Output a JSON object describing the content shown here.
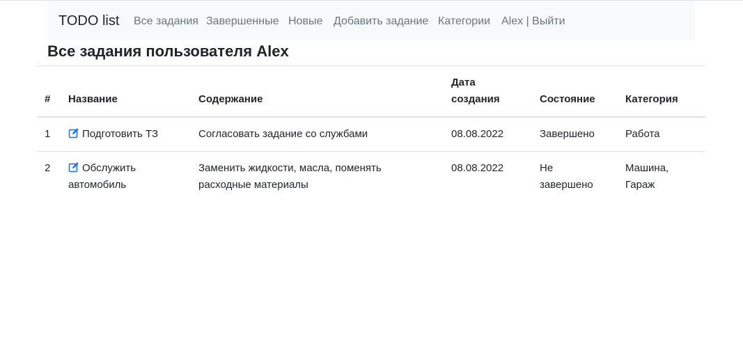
{
  "navbar": {
    "brand": "TODO list",
    "links": [
      "Все задания",
      "Завершенные",
      "Новые",
      "Добавить задание",
      "Категории",
      "Alex | Выйти"
    ]
  },
  "page": {
    "title": "Все задания пользователя Alex"
  },
  "table": {
    "headers": {
      "num": "#",
      "name": "Название",
      "content": "Содержание",
      "date_line1": "Дата",
      "date_line2": "создания",
      "state": "Состояние",
      "category": "Категория"
    },
    "rows": [
      {
        "num": "1",
        "name_line1": "Подготовить ТЗ",
        "content_line1": "Согласовать задание со службами",
        "date": "08.08.2022",
        "state_line1": "Завершено",
        "category_line1": "Работа"
      },
      {
        "num": "2",
        "name_line1": "Обслужить",
        "name_line2": "автомобиль",
        "content_line1": "Заменить жидкости, масла, поменять",
        "content_line2": "расходные материалы",
        "date": "08.08.2022",
        "state_line1": "Не",
        "state_line2": "завершено",
        "category_line1": "Машина,",
        "category_line2": "Гараж"
      }
    ]
  },
  "colors": {
    "navbar_bg": "#f8f9fa",
    "nav_link": "#6c757d",
    "edit_icon": "#0d6efd",
    "border": "#dee2e6"
  }
}
